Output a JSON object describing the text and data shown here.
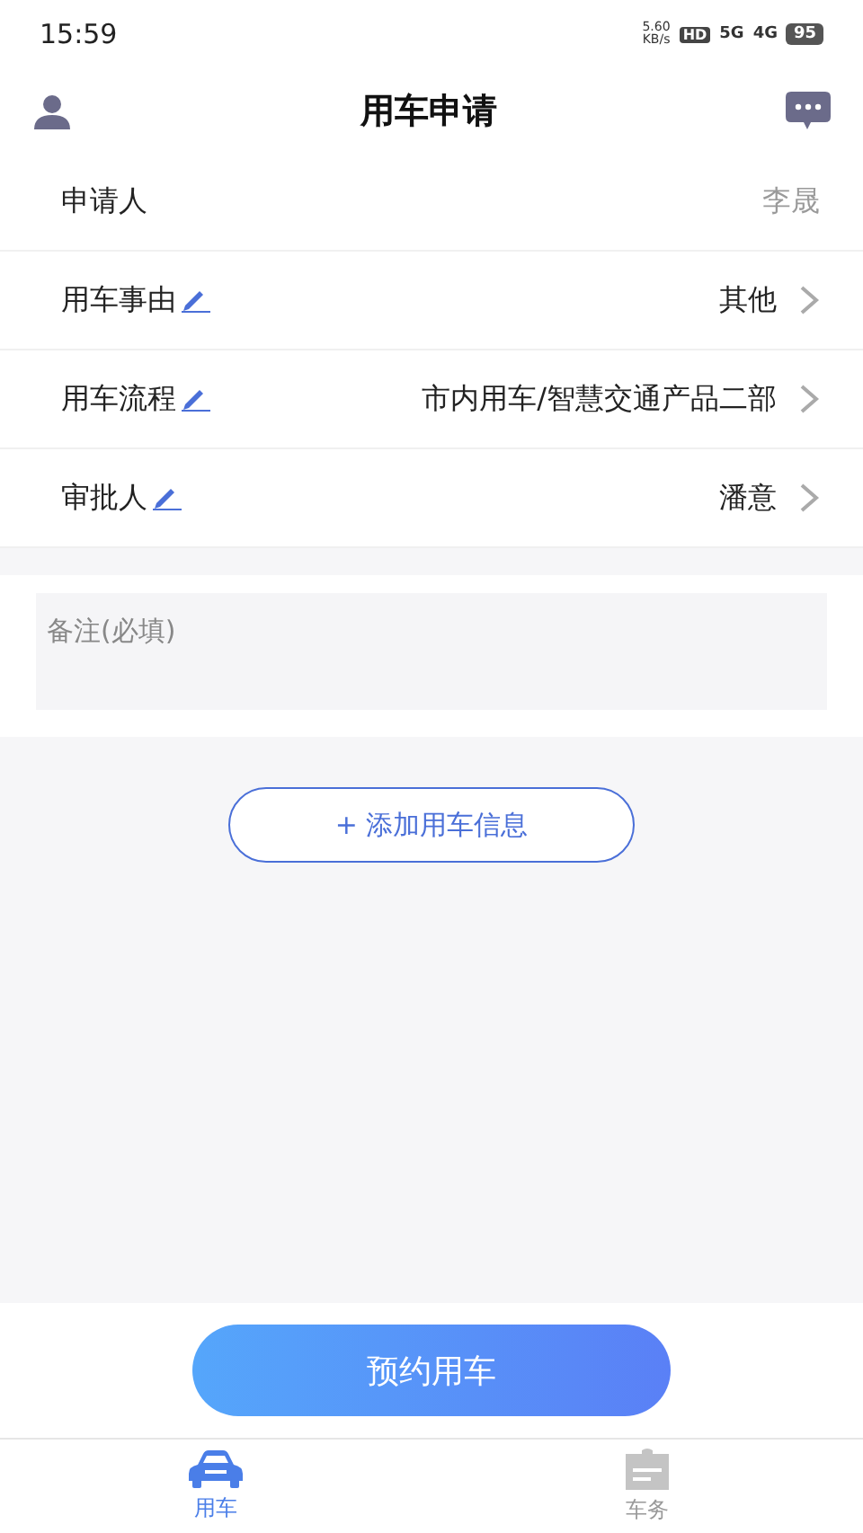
{
  "status_bar": {
    "time": "15:59",
    "speed_value": "5.60",
    "speed_unit": "KB/s",
    "hd": "HD",
    "network_1": "5G",
    "network_2": "4G",
    "battery": "95"
  },
  "header": {
    "title": "用车申请"
  },
  "form_rows": [
    {
      "label": "申请人",
      "value": "李晟",
      "kind": "readonly",
      "editable": false
    },
    {
      "label": "用车事由",
      "value": "其他",
      "kind": "select",
      "editable": true
    },
    {
      "label": "用车流程",
      "value": "市内用车/智慧交通产品二部",
      "kind": "select",
      "editable": true
    },
    {
      "label": "审批人",
      "value": "潘意",
      "kind": "select",
      "editable": true
    }
  ],
  "remarks": {
    "placeholder": "备注(必填)"
  },
  "add_button": {
    "label": "+ 添加用车信息"
  },
  "submit_button": {
    "label": "预约用车"
  },
  "tabs": [
    {
      "label": "用车",
      "selected": true,
      "kind": "car"
    },
    {
      "label": "车务",
      "selected": false,
      "kind": "clipboard"
    }
  ]
}
